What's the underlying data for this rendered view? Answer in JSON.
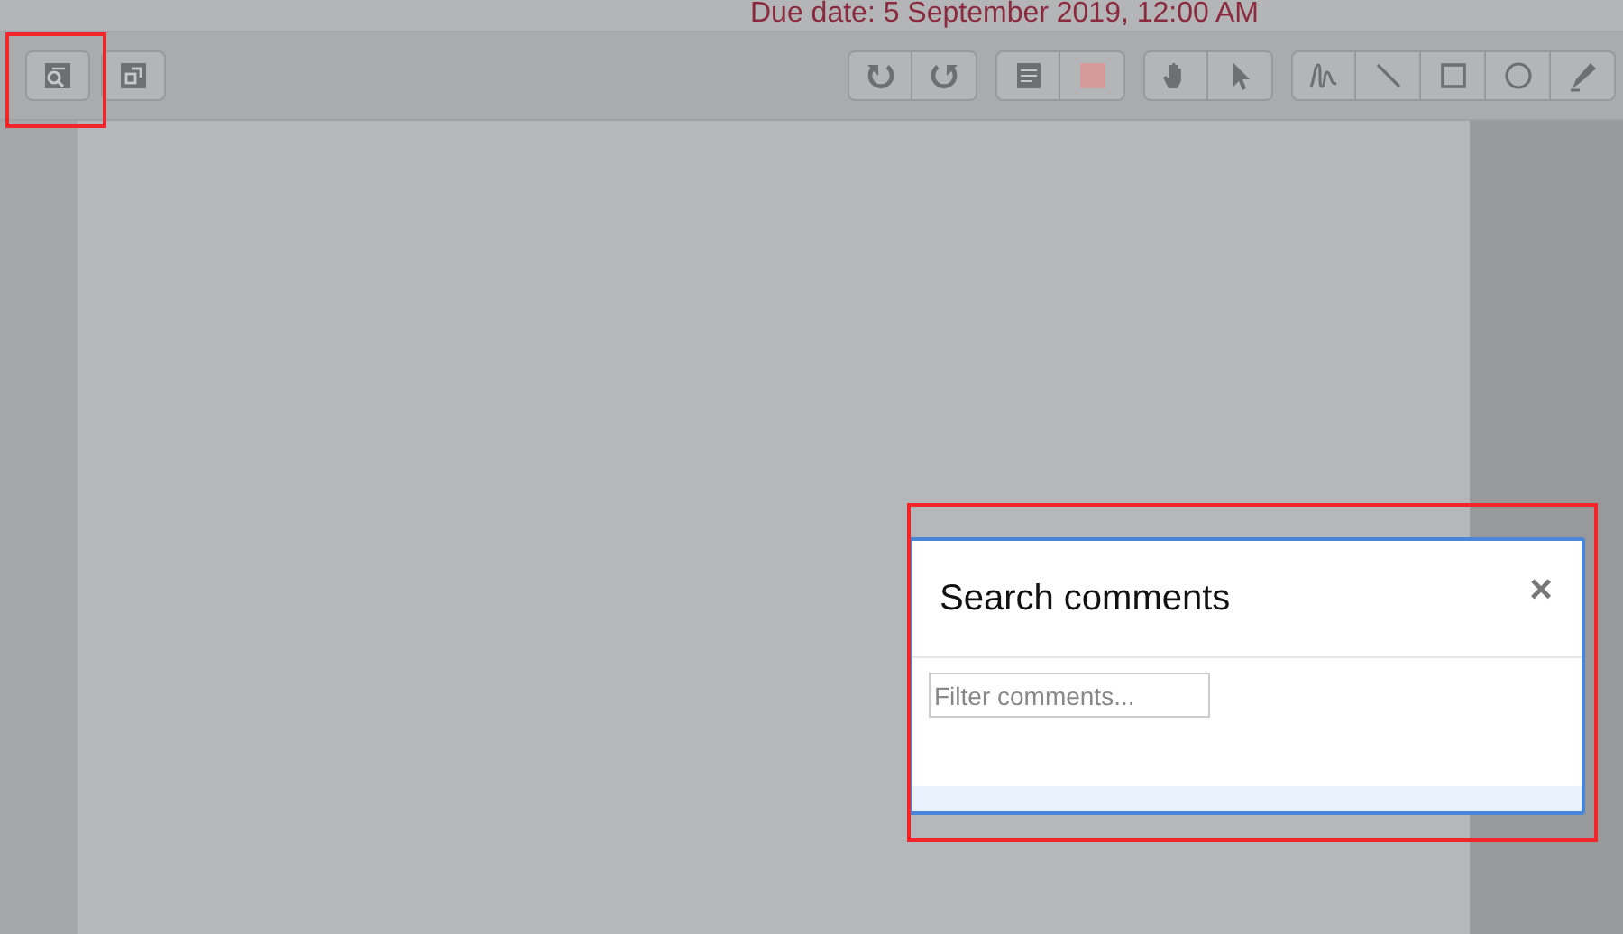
{
  "due_date": "Due date: 5 September 2019, 12:00 AM",
  "toolbar": {
    "left_groups": [
      [
        {
          "kind": "search-comments"
        }
      ],
      [
        {
          "kind": "expand"
        }
      ]
    ],
    "right_groups": [
      [
        {
          "kind": "undo"
        },
        {
          "kind": "redo"
        }
      ],
      [
        {
          "kind": "comment"
        },
        {
          "kind": "swatch",
          "color": "#d49a9c"
        }
      ],
      [
        {
          "kind": "hand"
        },
        {
          "kind": "pointer"
        }
      ],
      [
        {
          "kind": "pen"
        },
        {
          "kind": "line"
        },
        {
          "kind": "rectangle"
        },
        {
          "kind": "circle"
        },
        {
          "kind": "highlighter"
        }
      ]
    ]
  },
  "dialog": {
    "title": "Search comments",
    "close": "×",
    "filter": {
      "placeholder": "Filter comments..."
    }
  }
}
